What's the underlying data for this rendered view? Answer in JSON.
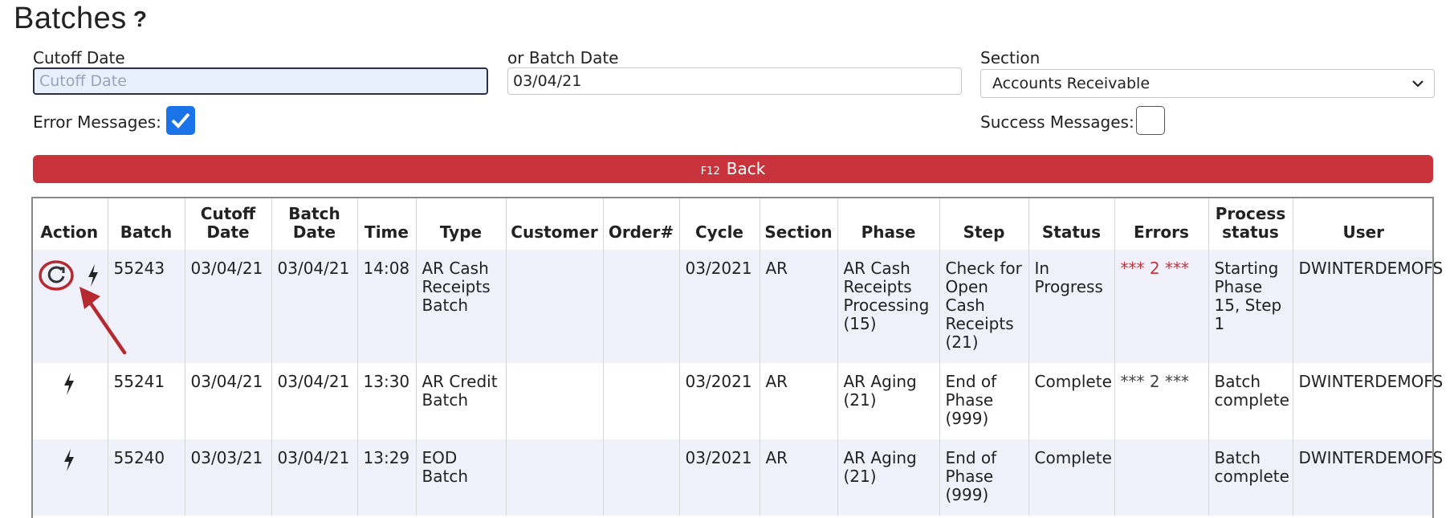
{
  "page": {
    "title": "Batches",
    "help_icon": "?"
  },
  "filters": {
    "cutoff_label": "Cutoff Date",
    "cutoff_placeholder": "Cutoff Date",
    "cutoff_value": "",
    "batch_label": "or Batch Date",
    "batch_value": "03/04/21",
    "section_label": "Section",
    "section_selected": "Accounts Receivable",
    "error_label": "Error Messages:",
    "error_checked": true,
    "success_label": "Success Messages:",
    "success_checked": false
  },
  "back_button": {
    "key": "F12",
    "label": "Back"
  },
  "table": {
    "columns": [
      "Action",
      "Batch",
      "Cutoff\nDate",
      "Batch\nDate",
      "Time",
      "Type",
      "Customer",
      "Order#",
      "Cycle",
      "Section",
      "Phase",
      "Step",
      "Status",
      "Errors",
      "Process\nstatus",
      "User"
    ],
    "rows": [
      {
        "actions": [
          "refresh-icon",
          "bolt-icon"
        ],
        "batch": "55243",
        "cutoff": "03/04/21",
        "batch_date": "03/04/21",
        "time": "14:08",
        "type": "AR Cash Receipts Batch",
        "customer": "",
        "order": "",
        "cycle": "03/2021",
        "section": "AR",
        "phase": "AR Cash Receipts Processing (15)",
        "step": "Check for Open Cash Receipts (21)",
        "status": "In Progress",
        "errors": "*** 2 ***",
        "errors_color": "#c8333c",
        "process_status": "Starting Phase 15, Step 1",
        "user": "DWINTERDEMOFS"
      },
      {
        "actions": [
          "bolt-icon"
        ],
        "batch": "55241",
        "cutoff": "03/04/21",
        "batch_date": "03/04/21",
        "time": "13:30",
        "type": "AR Credit Batch",
        "customer": "",
        "order": "",
        "cycle": "03/2021",
        "section": "AR",
        "phase": "AR Aging (21)",
        "step": "End of Phase (999)",
        "status": "Complete",
        "errors": "*** 2 ***",
        "errors_color": "#444444",
        "process_status": "Batch complete",
        "user": "DWINTERDEMOFS"
      },
      {
        "actions": [
          "bolt-icon"
        ],
        "batch": "55240",
        "cutoff": "03/03/21",
        "batch_date": "03/04/21",
        "time": "13:29",
        "type": "EOD Batch",
        "customer": "",
        "order": "",
        "cycle": "03/2021",
        "section": "AR",
        "phase": "AR Aging (21)",
        "step": "End of Phase (999)",
        "status": "Complete",
        "errors": "",
        "errors_color": "#444444",
        "process_status": "Batch complete",
        "user": "DWINTERDEMOFS"
      }
    ]
  },
  "colors": {
    "accent_red": "#c8333c",
    "checkbox_blue": "#1a73e8",
    "row_stripe": "#f0f1fb"
  }
}
